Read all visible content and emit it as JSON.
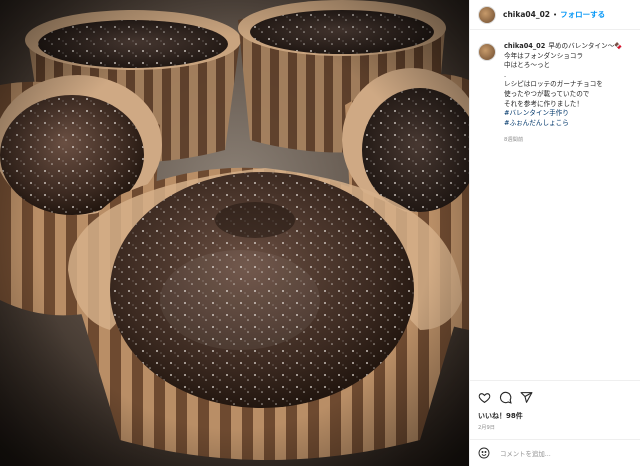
{
  "post": {
    "username": "chika04_02",
    "separator": "•",
    "follow_label": "フォローする",
    "caption_lines": [
      "早めのバレンタイン〜🍫",
      "今年はフォンダンショコラ",
      "中はとろ〜っと",
      ".",
      "レシピはロッテのガーナチョコを",
      "使ったやつが載っていたので",
      "それを参考に作りました！"
    ],
    "hashtags": [
      "#バレンタイン手作り",
      "#ふぉんだんしょこら"
    ],
    "caption_time": "8週間前",
    "likes": "いいね！98件",
    "date": "2月9日",
    "comment_placeholder": "コメントを追加...",
    "icons": [
      "heart-icon",
      "comment-icon",
      "share-icon",
      "emoji-icon"
    ],
    "photo_subject": "fondant-au-chocolat-cupcakes"
  }
}
